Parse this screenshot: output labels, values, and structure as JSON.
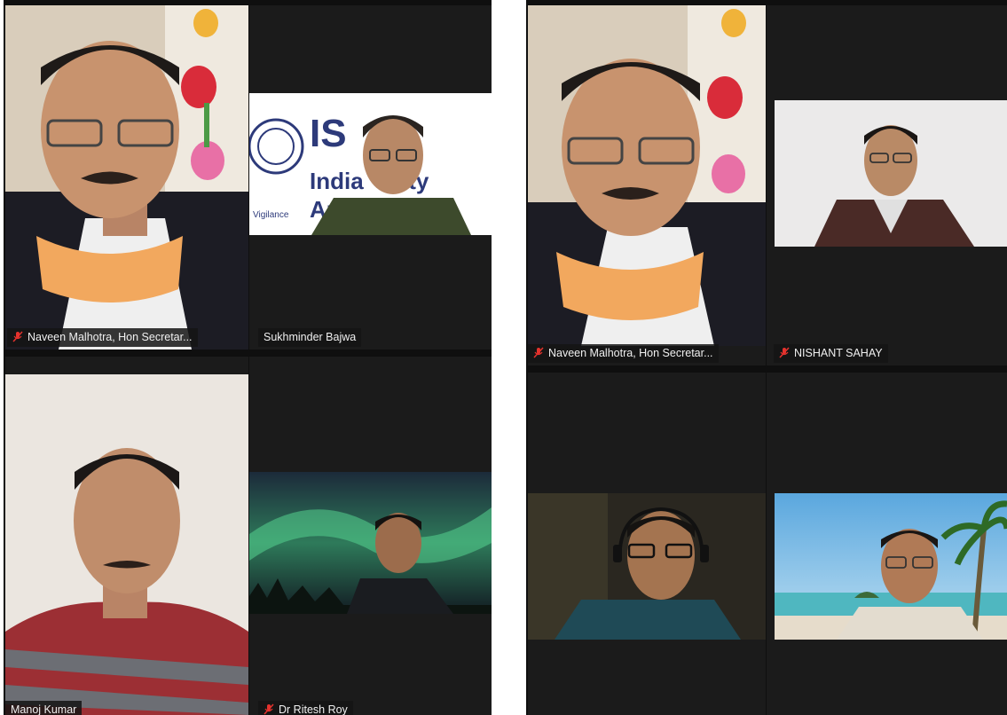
{
  "left_gallery": {
    "tiles": [
      {
        "name": "Naveen Malhotra, Hon Secretar...",
        "muted": true
      },
      {
        "name": "Sukhminder Bajwa",
        "muted": false
      },
      {
        "name": "Manoj Kumar",
        "muted": false
      },
      {
        "name": "Dr Ritesh Roy",
        "muted": true
      }
    ],
    "background_text": {
      "logo_letters": "IS",
      "line1": "India  ciety",
      "line2": "An    iolog",
      "seal_bottom": "Vigilance"
    }
  },
  "right_gallery": {
    "tiles": [
      {
        "name": "Naveen Malhotra, Hon Secretar...",
        "muted": true
      },
      {
        "name": "NISHANT SAHAY",
        "muted": true
      },
      {
        "name": "",
        "muted": false
      },
      {
        "name": "",
        "muted": false
      }
    ]
  },
  "colors": {
    "muted_icon": "#e5322d",
    "tile_bg": "#1b1b1b",
    "label_bg": "#141414"
  }
}
